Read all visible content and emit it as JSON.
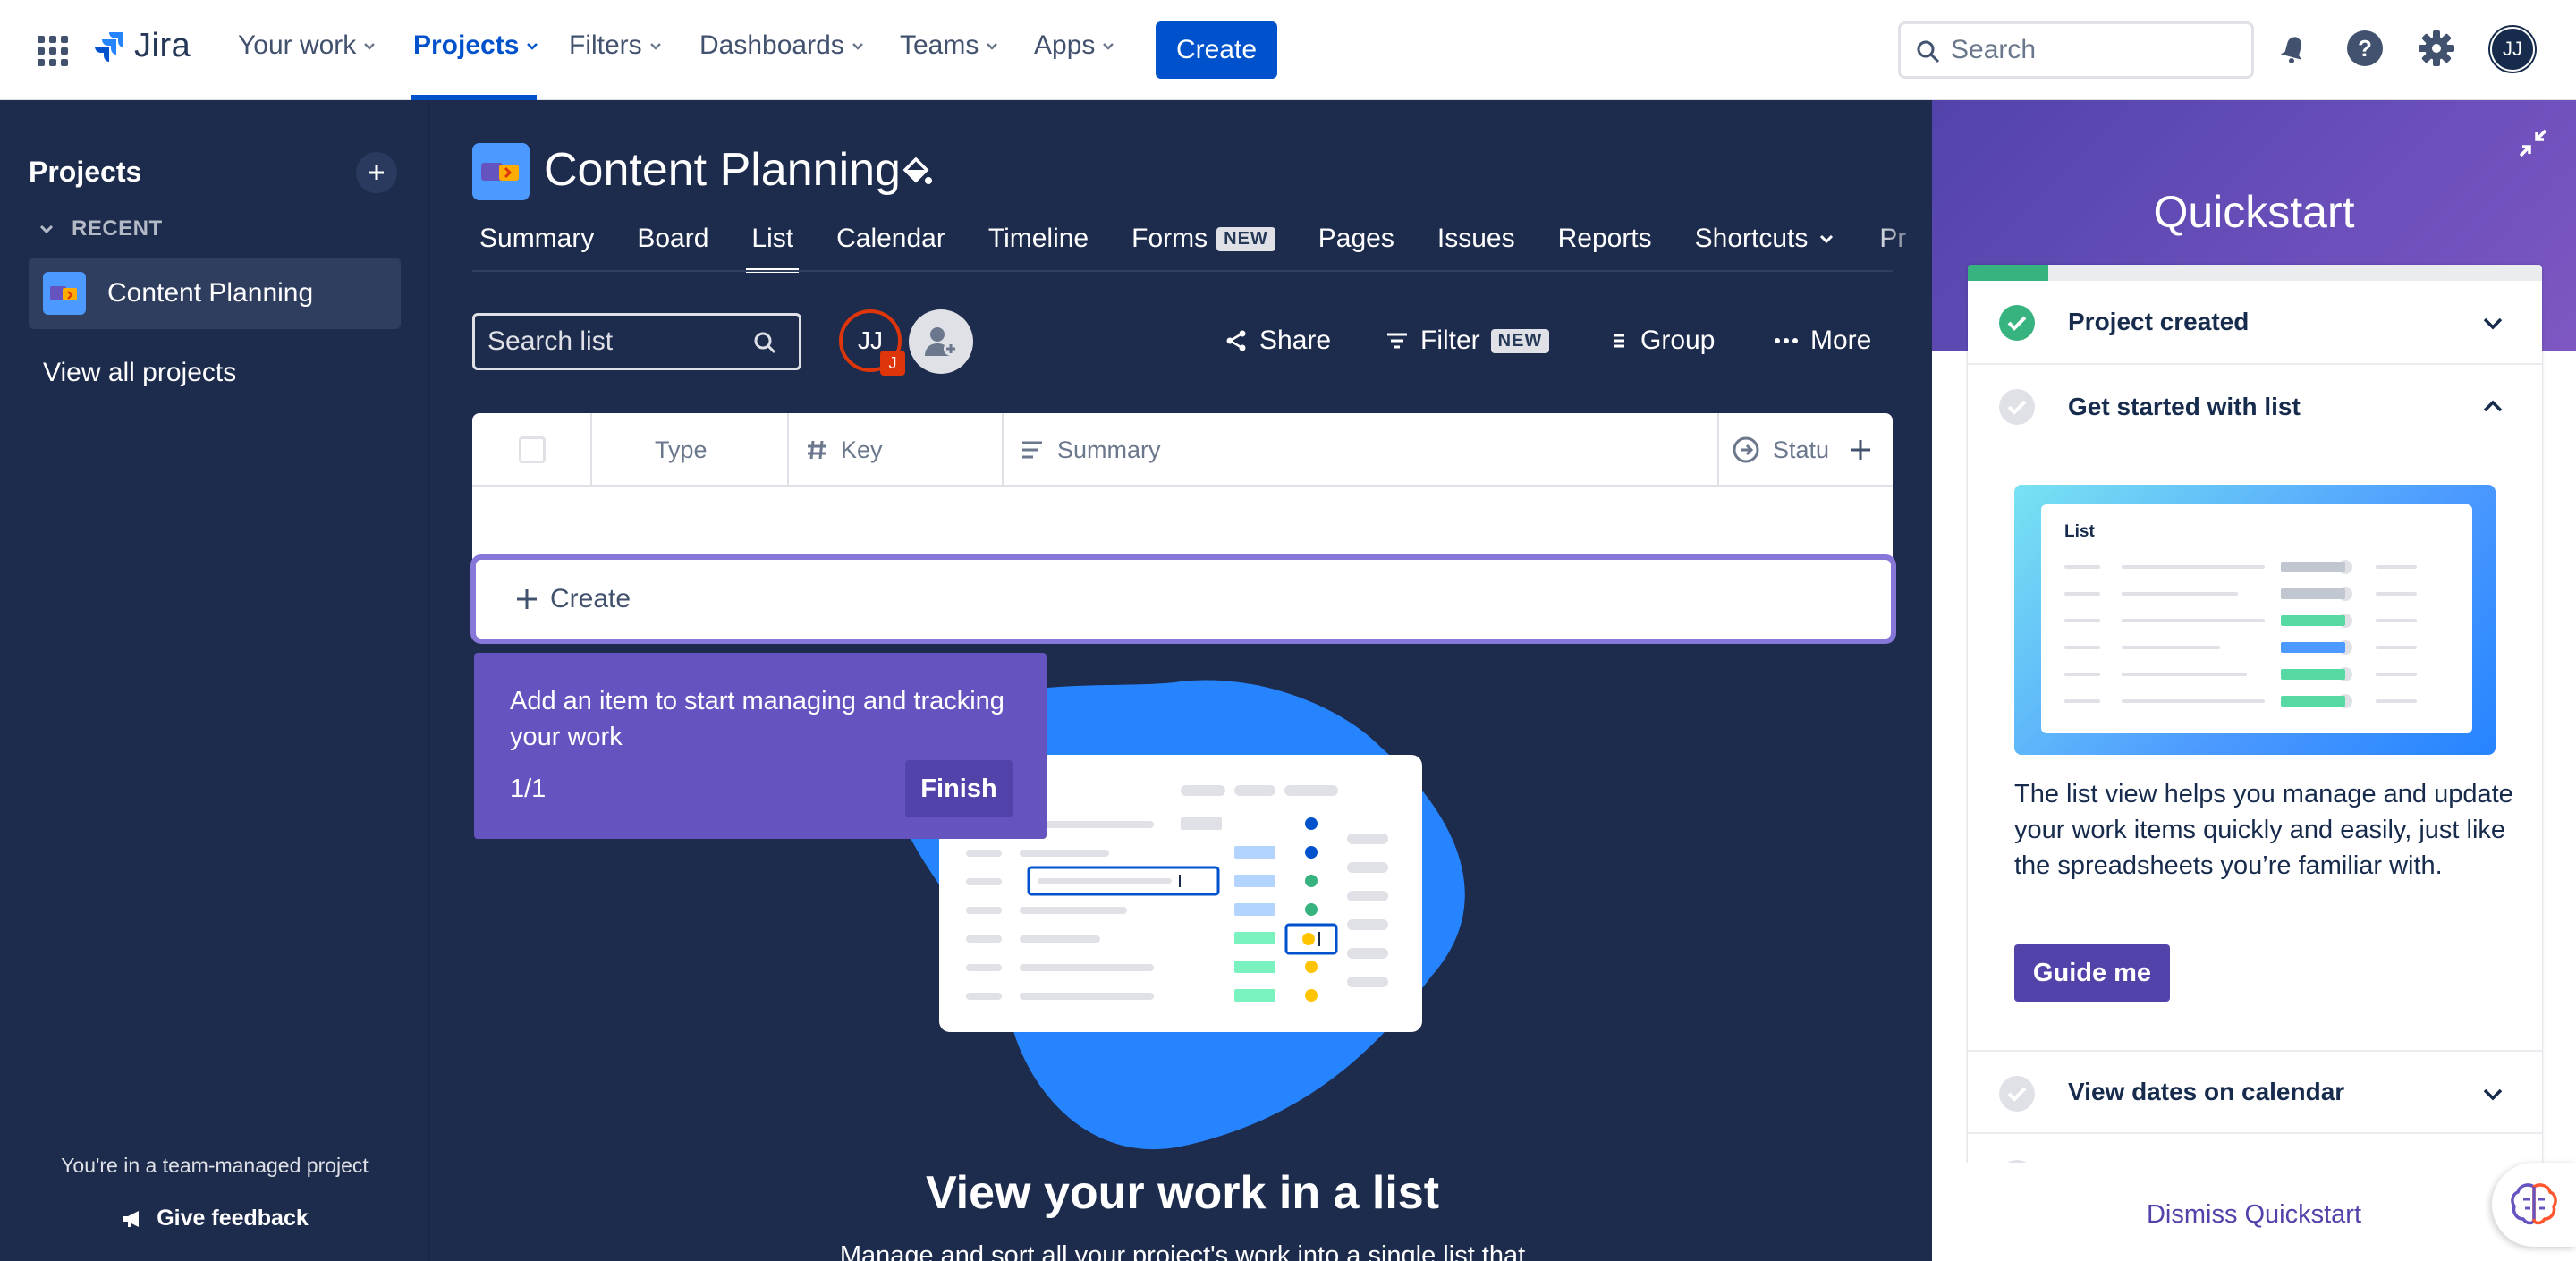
{
  "topnav": {
    "logo_text": "Jira",
    "items": [
      {
        "label": "Your work"
      },
      {
        "label": "Projects"
      },
      {
        "label": "Filters"
      },
      {
        "label": "Dashboards"
      },
      {
        "label": "Teams"
      },
      {
        "label": "Apps"
      }
    ],
    "create_label": "Create",
    "search_placeholder": "Search",
    "avatar_initials": "JJ"
  },
  "sidebar": {
    "title": "Projects",
    "recent_label": "RECENT",
    "project_name": "Content Planning",
    "view_all": "View all projects",
    "team_note": "You're in a team-managed project",
    "feedback": "Give feedback"
  },
  "project": {
    "title": "Content Planning",
    "tabs": [
      {
        "label": "Summary"
      },
      {
        "label": "Board"
      },
      {
        "label": "List"
      },
      {
        "label": "Calendar"
      },
      {
        "label": "Timeline"
      },
      {
        "label": "Forms",
        "badge": "NEW"
      },
      {
        "label": "Pages"
      },
      {
        "label": "Issues"
      },
      {
        "label": "Reports"
      },
      {
        "label": "Shortcuts"
      },
      {
        "label": "Pr"
      }
    ]
  },
  "toolbar": {
    "search_placeholder": "Search list",
    "avatar_initials": "JJ",
    "avatar_badge": "J",
    "share": "Share",
    "filter": "Filter",
    "filter_badge": "NEW",
    "group": "Group",
    "more": "More"
  },
  "table": {
    "columns": [
      "Type",
      "Key",
      "Summary",
      "Statu"
    ],
    "create_label": "Create"
  },
  "tooltip": {
    "text": "Add an item to start managing and tracking your work",
    "count": "1/1",
    "finish": "Finish"
  },
  "empty_state": {
    "title": "View your work in a list",
    "subtitle": "Manage and sort all your project's work into a single list that"
  },
  "quickstart": {
    "title": "Quickstart",
    "progress_fraction": 0.14,
    "items": [
      {
        "label": "Project created",
        "done": true
      },
      {
        "label": "Get started with list",
        "done": false
      }
    ],
    "image_label": "List",
    "description": "The list view helps you manage and update your work items quickly and easily, just like the spreadsheets you’re familiar with.",
    "guide_button": "Guide me",
    "next_item": "View dates on calendar",
    "dismiss": "Dismiss Quickstart"
  },
  "colors": {
    "brand_blue": "#0052CC",
    "dark_bg": "#1D2B4C",
    "purple": "#6554C0",
    "success": "#36B37E"
  }
}
